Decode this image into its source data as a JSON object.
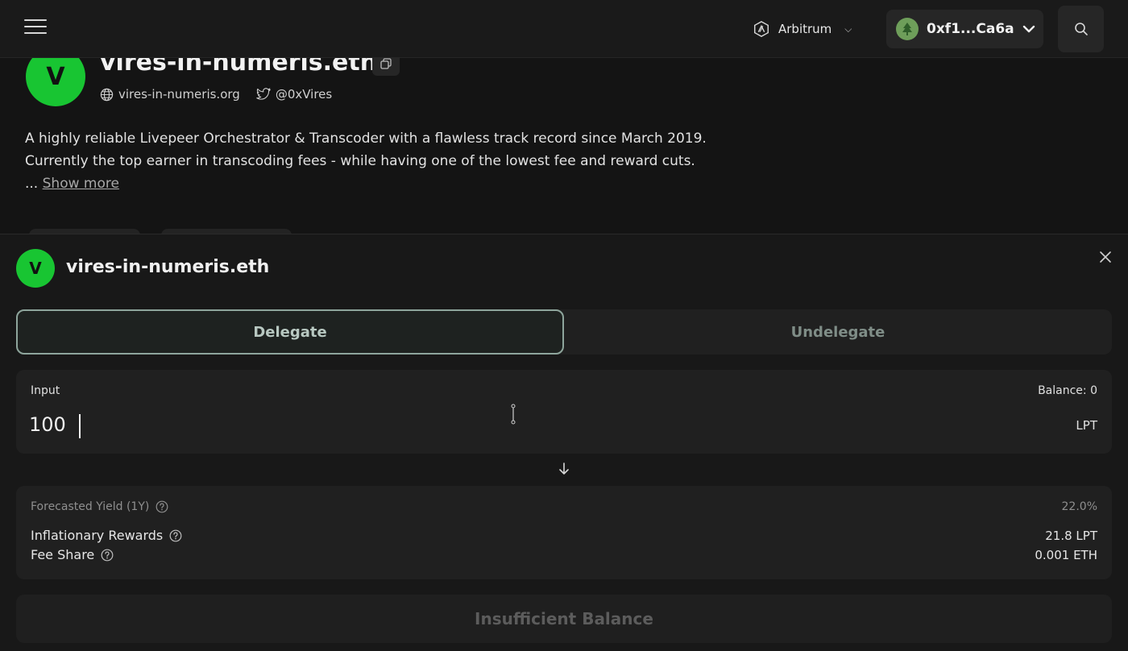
{
  "topbar": {
    "network": {
      "name": "Arbitrum",
      "icon": "arbitrum-logo-icon"
    },
    "account": {
      "address": "0xf1...Ca6a",
      "icon": "tree-avatar-icon"
    }
  },
  "profile": {
    "avatar_letter": "V",
    "name": "vires-in-numeris.eth",
    "website": "vires-in-numeris.org",
    "twitter": "@0xVires",
    "description_line1": "A highly reliable Livepeer Orchestrator & Transcoder with a flawless track record since March 2019.",
    "description_line2": "Currently the top earner in transcoding fees - while having one of the lowest fee and reward cuts.",
    "ellipsis": "...",
    "show_more": "Show more",
    "avatar_color": "#18c532"
  },
  "modal": {
    "avatar_letter": "V",
    "title": "vires-in-numeris.eth",
    "tabs": [
      {
        "label": "Delegate",
        "active": true
      },
      {
        "label": "Undelegate",
        "active": false
      }
    ],
    "input": {
      "label": "Input",
      "balance": "Balance: 0",
      "value": "100",
      "token": "LPT"
    },
    "forecast": {
      "yield_label": "Forecasted Yield (1Y)",
      "yield_value": "22.0%",
      "inflationary_label": "Inflationary Rewards",
      "inflationary_value": "21.8 LPT",
      "fee_share_label": "Fee Share",
      "fee_share_value": "0.001 ETH"
    },
    "submit_label": "Insufficient Balance"
  }
}
